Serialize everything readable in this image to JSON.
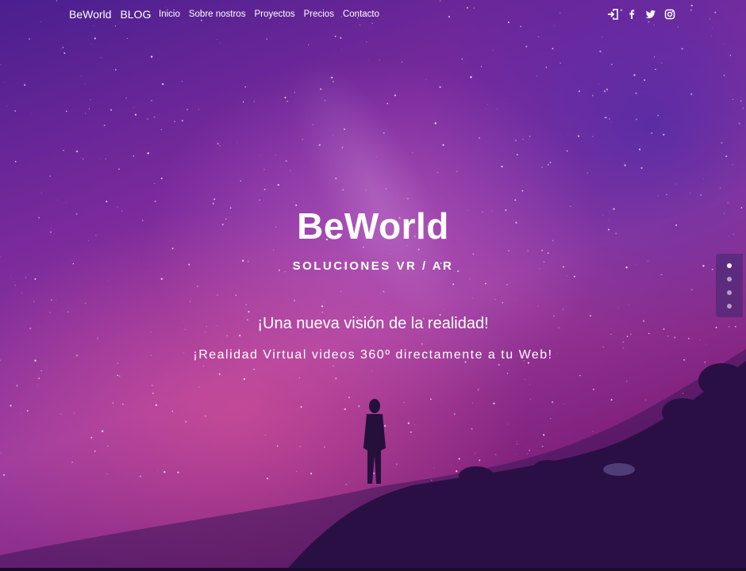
{
  "nav": {
    "brand": "BeWorld",
    "blog": "BLOG",
    "links": [
      "Inicio",
      "Sobre nostros",
      "Proyectos",
      "Precios",
      "Contacto"
    ],
    "icons": [
      "login-icon",
      "facebook-icon",
      "twitter-icon",
      "instagram-icon"
    ]
  },
  "hero": {
    "title": "BeWorld",
    "subtitle": "SOLUCIONES VR / AR",
    "tagline": "¡Una nueva visión de la realidad!",
    "description": "¡Realidad Virtual videos 360º directamente a tu Web!"
  },
  "section_nav": {
    "count": 4,
    "active_index": 0
  },
  "colors": {
    "text": "#ffffff",
    "bg_top": "#4a1f8f",
    "bg_pink": "#e85896",
    "bg_bottom": "#5a1a6e"
  }
}
